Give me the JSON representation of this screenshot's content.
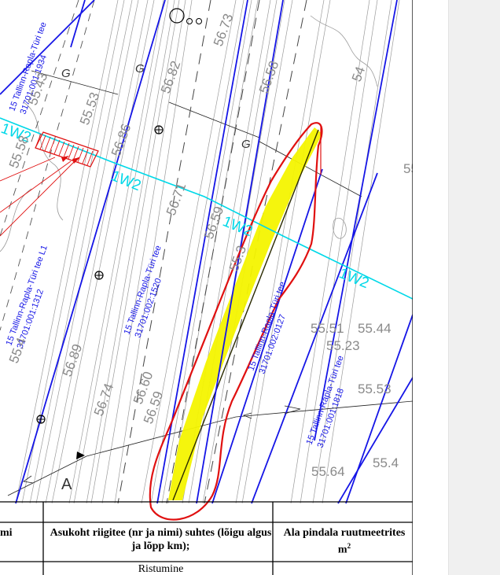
{
  "colors": {
    "parcel_line": "#1515e6",
    "utility_line": "#00d8e8",
    "highlight": "#f4f400",
    "markup": "#e01010",
    "survey_line": "#9a9a9a",
    "panel_bg": "#f0f0f0"
  },
  "map": {
    "parcel_labels": [
      {
        "road": "15 Tallinn-Rapla-Türi tee",
        "id": "31701:001:1934"
      },
      {
        "road": "15 Tallinn-Rapla-Türi tee L1",
        "id": "31701:001:1312"
      },
      {
        "road": "15 Tallinn-Rapla-Türi tee",
        "id": "31701:002:1520"
      },
      {
        "road": "15 Tallinn-Rapla-Türi tee",
        "id": "31701:002:0127"
      },
      {
        "road": "15 Tallinn-Rapla-Türi tee",
        "id": "31701:001:1818"
      }
    ],
    "utility_labels": [
      "1W2",
      "1W2",
      "1W2",
      "1W2"
    ],
    "line_labels": [
      "G",
      "G",
      "G"
    ],
    "section_label": "A",
    "elevations": [
      "56.73",
      "56.58",
      "56.82",
      "56.86",
      "56.71",
      "56.59",
      "55.51",
      "55.44",
      "55.53",
      "56.60",
      "56.59",
      "55.64",
      "55.4",
      "56.74",
      "56.89",
      "55.58",
      "55.43",
      "55.53",
      "55.4",
      "55.3",
      "55.5",
      "55.23",
      "54"
    ]
  },
  "table": {
    "col1_header": "mi",
    "col2_header": "Asukoht riigitee (nr ja nimi) suhtes (lõigu algus ja lõpp km);",
    "col3_header": "Ala pindala ruutmeetrites m",
    "col3_header_sup": "2",
    "row1_col2": "Ristumine"
  },
  "panel_icons": [
    "side-panel"
  ]
}
